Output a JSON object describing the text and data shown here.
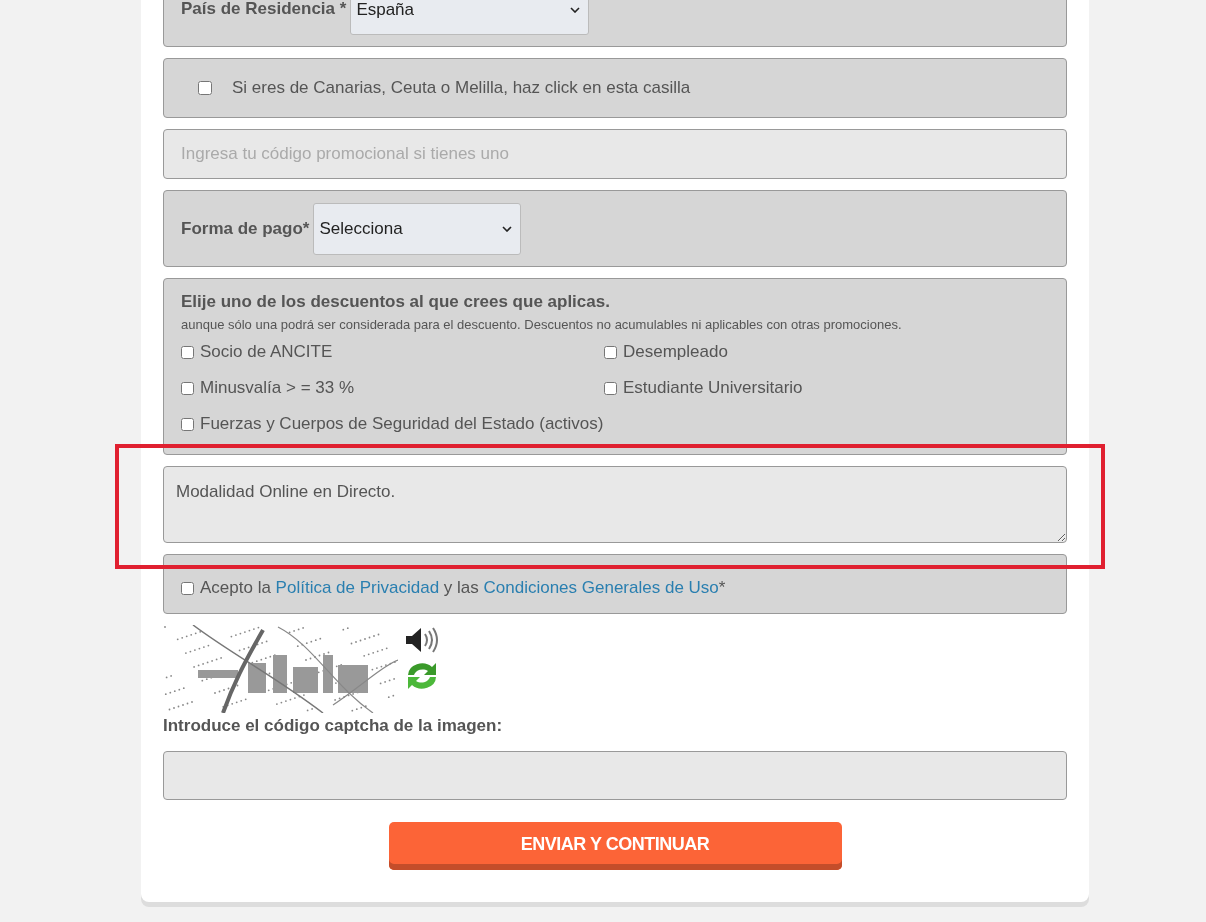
{
  "residence": {
    "label": "País de Residencia *",
    "value": "España"
  },
  "islands_option": {
    "label": "Si eres de Canarias, Ceuta o Melilla, haz click en esta casilla",
    "checked": false
  },
  "promo_field": {
    "placeholder": "Ingresa tu código promocional si tienes uno"
  },
  "payment": {
    "label": "Forma de pago*",
    "value": "Selecciona"
  },
  "discounts": {
    "title": "Elije uno de los descuentos al que crees que aplicas.",
    "note": "aunque sólo una podrá ser considerada para el descuento. Descuentos no acumulables ni aplicables con otras promociones.",
    "options": [
      {
        "label": "Socio de ANCITE",
        "checked": false
      },
      {
        "label": "Desempleado",
        "checked": false
      },
      {
        "label": "Minusvalía > = 33 %",
        "checked": false
      },
      {
        "label": "Estudiante Universitario",
        "checked": false
      },
      {
        "label": "Fuerzas y Cuerpos de Seguridad del Estado (activos)",
        "checked": false
      }
    ]
  },
  "comments": {
    "value": "Modalidad Online en Directo.",
    "highlighted": true
  },
  "terms": {
    "checked": false,
    "segments": [
      {
        "kind": "text",
        "text": "Acepto la "
      },
      {
        "kind": "link",
        "text": "Política de Privacidad"
      },
      {
        "kind": "text",
        "text": " y las "
      },
      {
        "kind": "link",
        "text": "Condiciones Generales de Uso"
      },
      {
        "kind": "text",
        "text": "*"
      }
    ]
  },
  "captcha": {
    "label": "Introduce el código captcha de la imagen:"
  },
  "submit_button": "ENVIAR Y CONTINUAR"
}
